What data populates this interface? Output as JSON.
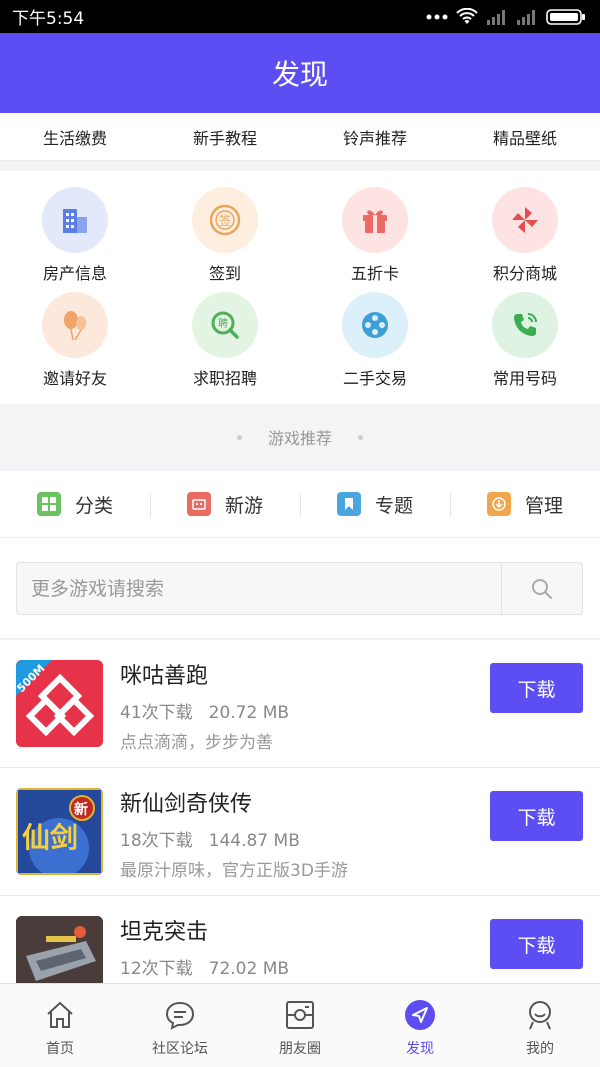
{
  "status_bar": {
    "time": "下午5:54"
  },
  "header": {
    "title": "发现"
  },
  "quick_links": [
    "生活缴费",
    "新手教程",
    "铃声推荐",
    "精品壁纸"
  ],
  "services": [
    {
      "label": "房产信息",
      "icon": "building-icon",
      "bg": "#e3e8fb",
      "color": "#5b7ee6"
    },
    {
      "label": "签到",
      "icon": "checkin-stamp-icon",
      "bg": "#fdeee0",
      "color": "#e9a55b"
    },
    {
      "label": "五折卡",
      "icon": "gift-icon",
      "bg": "#fde3e1",
      "color": "#ec6a63"
    },
    {
      "label": "积分商城",
      "icon": "pinwheel-icon",
      "bg": "#fde3e3",
      "color": "#e24f4f"
    },
    {
      "label": "邀请好友",
      "icon": "balloons-icon",
      "bg": "#fde9dc",
      "color": "#f0a268"
    },
    {
      "label": "求职招聘",
      "icon": "job-search-icon",
      "bg": "#e3f4e3",
      "color": "#4fae5a"
    },
    {
      "label": "二手交易",
      "icon": "film-reel-icon",
      "bg": "#dcf0fa",
      "color": "#3d9fd6"
    },
    {
      "label": "常用号码",
      "icon": "phone-icon",
      "bg": "#def3e1",
      "color": "#3cad52"
    }
  ],
  "game_section": {
    "title": "游戏推荐"
  },
  "game_tabs": [
    {
      "label": "分类",
      "icon": "category-grid-icon",
      "color": "#6cc162"
    },
    {
      "label": "新游",
      "icon": "new-game-icon",
      "color": "#ea6b62"
    },
    {
      "label": "专题",
      "icon": "bookmark-icon",
      "color": "#4ba6df"
    },
    {
      "label": "管理",
      "icon": "download-manage-icon",
      "color": "#f0a54e"
    }
  ],
  "search": {
    "placeholder": "更多游戏请搜索"
  },
  "games": [
    {
      "name": "咪咕善跑",
      "downloads": "41次下载",
      "size": "20.72 MB",
      "desc": "点点滴滴，步步为善",
      "button": "下载",
      "badge": "500M"
    },
    {
      "name": "新仙剑奇侠传",
      "downloads": "18次下载",
      "size": "144.87 MB",
      "desc": "最原汁原味，官方正版3D手游",
      "button": "下载",
      "thumb_text": "仙剑",
      "thumb_badge": "新"
    },
    {
      "name": "坦克突击",
      "downloads": "12次下载",
      "size": "72.02 MB",
      "desc": "",
      "button": "下载"
    }
  ],
  "bottom_nav": [
    {
      "label": "首页",
      "icon": "home-icon",
      "active": false
    },
    {
      "label": "社区论坛",
      "icon": "chat-bubble-icon",
      "active": false
    },
    {
      "label": "朋友圈",
      "icon": "moments-icon",
      "active": false
    },
    {
      "label": "发现",
      "icon": "discover-compass-icon",
      "active": true
    },
    {
      "label": "我的",
      "icon": "profile-icon",
      "active": false
    }
  ],
  "colors": {
    "accent": "#5d4ef3"
  }
}
